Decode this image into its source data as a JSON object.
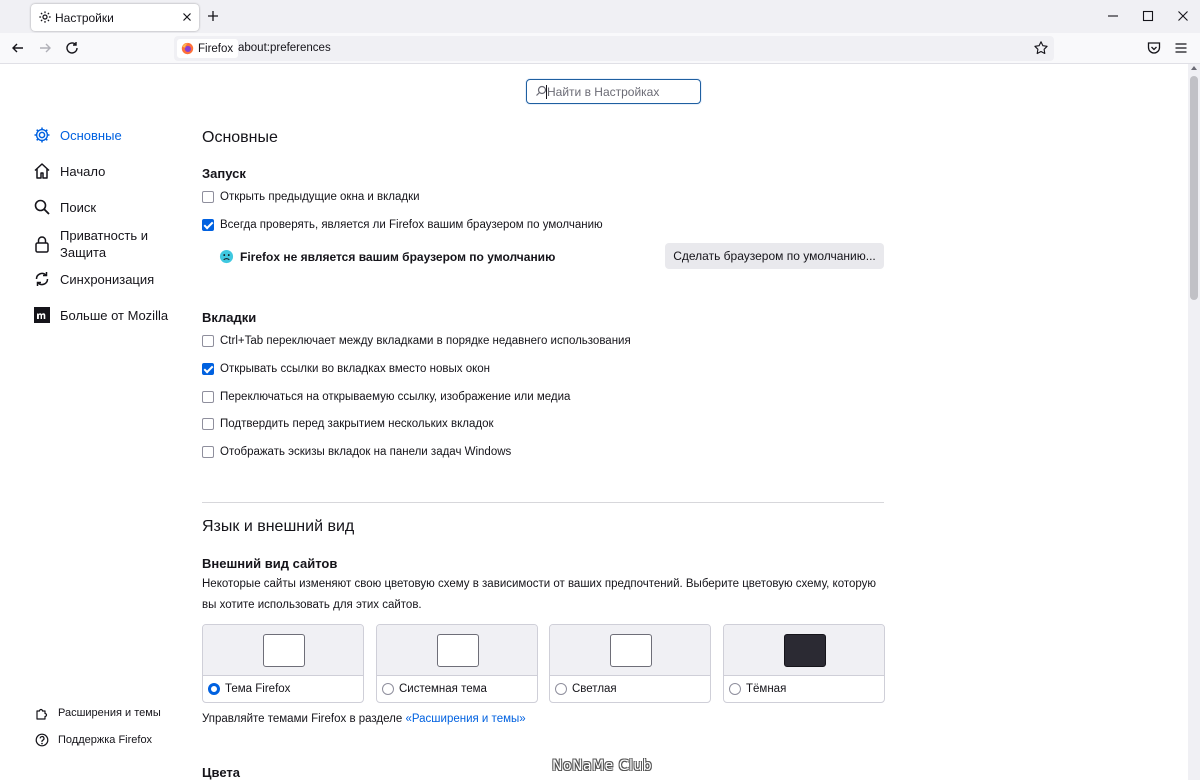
{
  "browser": {
    "tab_title": "Настройки",
    "identity_label": "Firefox",
    "url": "about:preferences"
  },
  "search": {
    "placeholder": "Найти в Настройках"
  },
  "sidebar": {
    "items": [
      {
        "label": "Основные",
        "icon": "gear-icon",
        "selected": true
      },
      {
        "label": "Начало",
        "icon": "home-icon",
        "selected": false
      },
      {
        "label": "Поиск",
        "icon": "search-icon",
        "selected": false
      },
      {
        "label": "Приватность и Защита",
        "icon": "lock-icon",
        "selected": false
      },
      {
        "label": "Синхронизация",
        "icon": "sync-icon",
        "selected": false
      },
      {
        "label": "Больше от Mozilla",
        "icon": "mozilla-icon",
        "selected": false
      }
    ],
    "footer": [
      {
        "label": "Расширения и темы",
        "icon": "puzzle-icon"
      },
      {
        "label": "Поддержка Firefox",
        "icon": "help-icon"
      }
    ]
  },
  "main": {
    "title": "Основные",
    "startup": {
      "heading": "Запуск",
      "options": [
        {
          "label": "Открыть предыдущие окна и вкладки",
          "checked": false
        },
        {
          "label": "Всегда проверять, является ли Firefox вашим браузером по умолчанию",
          "checked": true
        }
      ],
      "default_status": "Firefox не является вашим браузером по умолчанию",
      "default_button": "Сделать браузером по умолчанию..."
    },
    "tabs": {
      "heading": "Вкладки",
      "options": [
        {
          "label": "Ctrl+Tab переключает между вкладками в порядке недавнего использования",
          "checked": false
        },
        {
          "label": "Открывать ссылки во вкладках вместо новых окон",
          "checked": true
        },
        {
          "label": "Переключаться на открываемую ссылку, изображение или медиа",
          "checked": false
        },
        {
          "label": "Подтвердить перед закрытием нескольких вкладок",
          "checked": false
        },
        {
          "label": "Отображать эскизы вкладок на панели задач Windows",
          "checked": false
        }
      ]
    },
    "language_section": {
      "title": "Язык и внешний вид",
      "sites_heading": "Внешний вид сайтов",
      "sites_description": "Некоторые сайты изменяют свою цветовую схему в зависимости от ваших предпочтений. Выберите цветовую схему, которую вы хотите использовать для этих сайтов.",
      "themes": [
        {
          "label": "Тема Firefox",
          "selected": true,
          "dark": false
        },
        {
          "label": "Системная тема",
          "selected": false,
          "dark": false
        },
        {
          "label": "Светлая",
          "selected": false,
          "dark": false
        },
        {
          "label": "Тёмная",
          "selected": false,
          "dark": true
        }
      ],
      "manage_text": "Управляйте темами Firefox в разделе ",
      "manage_link": "«Расширения и темы»",
      "colors_heading": "Цвета"
    }
  },
  "watermark": "NoNaMe Club",
  "colors": {
    "accent": "#0061e0",
    "text": "#15141a"
  }
}
